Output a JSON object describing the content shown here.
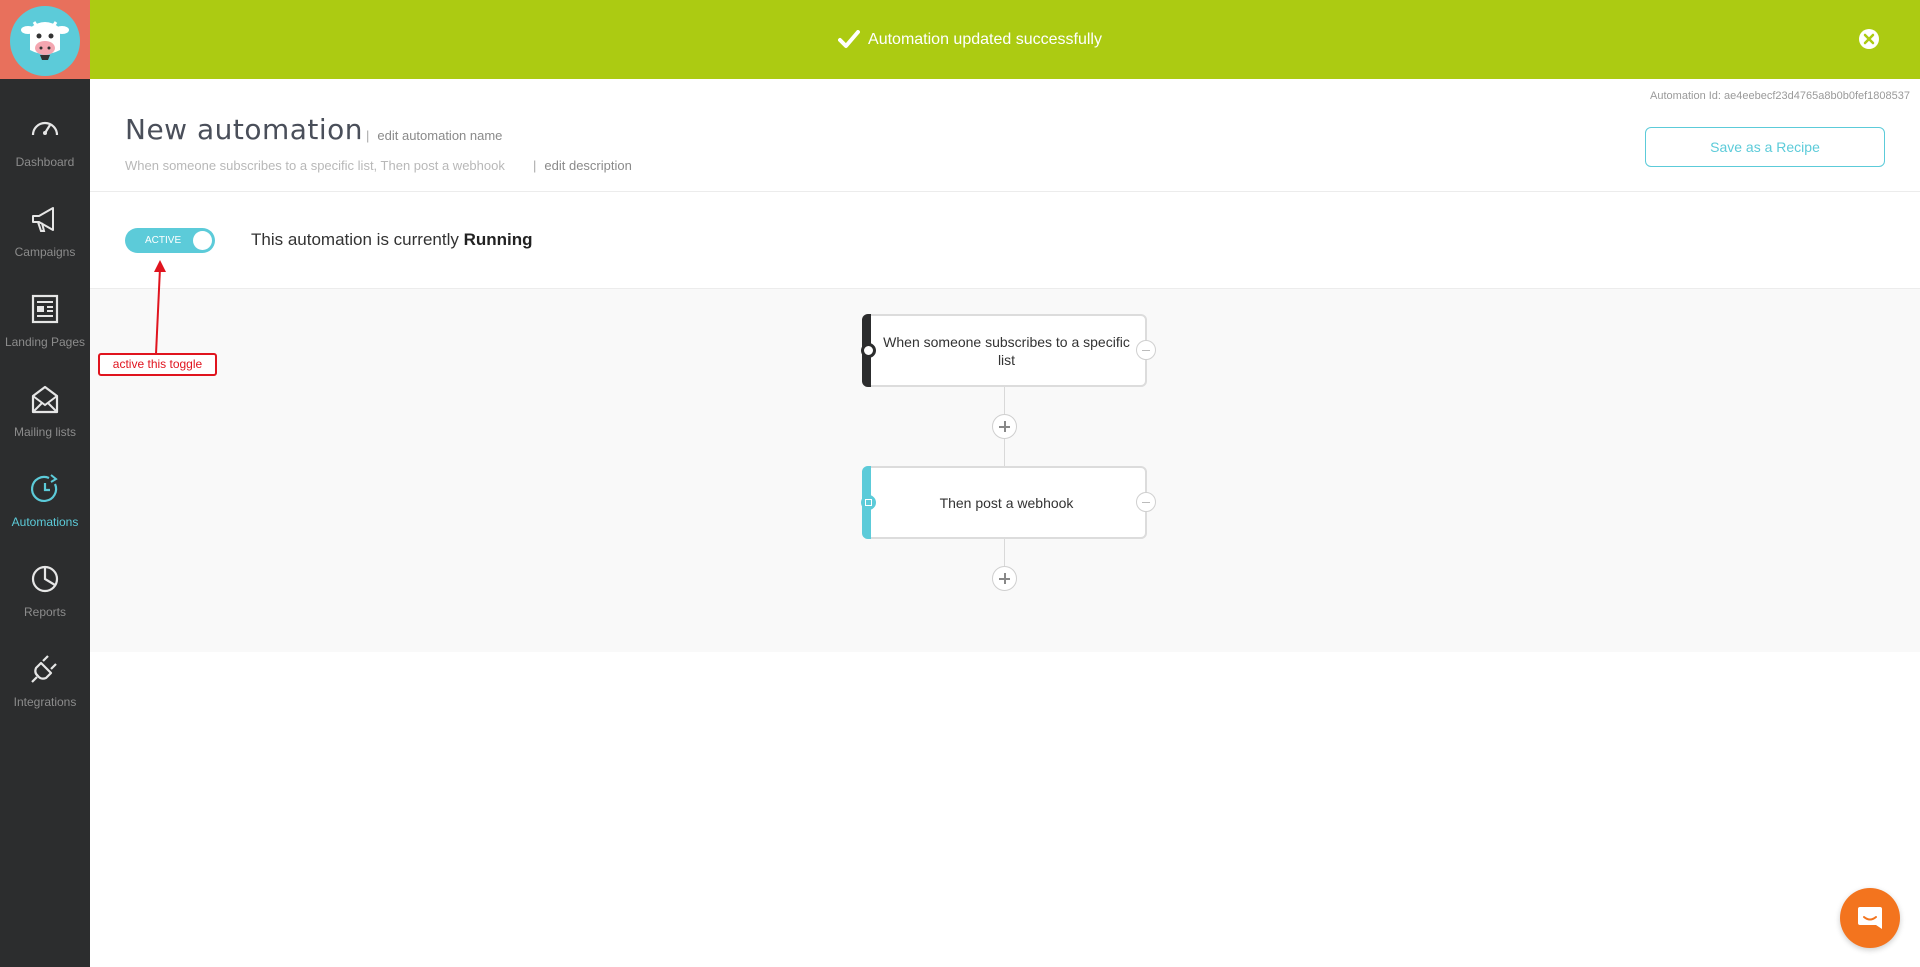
{
  "notification": {
    "message": "Automation updated successfully",
    "accent_color": "#accb12"
  },
  "sidebar": {
    "background": "#2c2d2e",
    "active_color": "#5ccbd9",
    "items": [
      {
        "label": "Dashboard",
        "icon": "speedometer-icon"
      },
      {
        "label": "Campaigns",
        "icon": "megaphone-icon"
      },
      {
        "label": "Landing Pages",
        "icon": "landing-page-icon"
      },
      {
        "label": "Mailing lists",
        "icon": "mailing-list-icon"
      },
      {
        "label": "Automations",
        "icon": "automation-clock-icon",
        "active": true
      },
      {
        "label": "Reports",
        "icon": "pie-chart-icon"
      },
      {
        "label": "Integrations",
        "icon": "plug-icon"
      }
    ]
  },
  "header": {
    "automation_id": "Automation Id: ae4eebecf23d4765a8b0b0fef1808537",
    "title": "New automation",
    "edit_name": "edit automation name",
    "description": "When someone subscribes to a specific list, Then post a webhook",
    "edit_description": "edit description",
    "save_recipe": "Save as a Recipe"
  },
  "status": {
    "toggle_label": "ACTIVE",
    "toggle_on": true,
    "text_prefix": "This automation is currently",
    "state": "Running"
  },
  "annotation": {
    "text": "active this toggle",
    "color": "#e0141e"
  },
  "workflow": {
    "steps": [
      {
        "label": "When someone subscribes to a specific list",
        "type": "trigger"
      },
      {
        "label": "Then post a webhook",
        "type": "action"
      }
    ]
  }
}
